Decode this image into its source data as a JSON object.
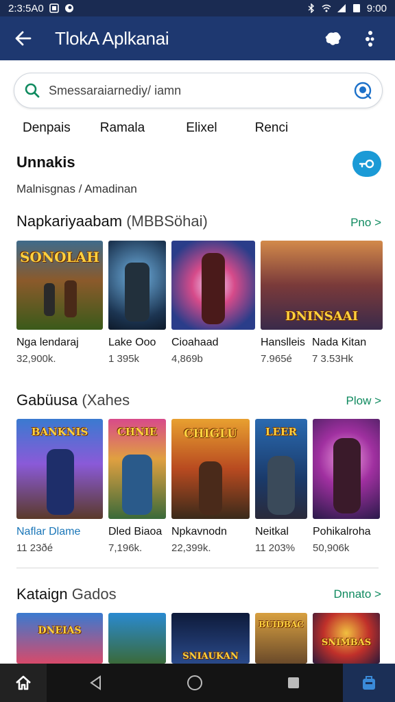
{
  "status_bar": {
    "time": "2:3:5A0",
    "clock_right": "9:00"
  },
  "app_bar": {
    "title": "Tlok​A Aplkanai"
  },
  "search": {
    "placeholder": "Smessaraiarnediy/ iamn"
  },
  "tabs": [
    "Denpais",
    "Ramala",
    "Elixel",
    "Renci"
  ],
  "user_section": {
    "title": "Unnakis",
    "breadcrumb": "Malnisgnas  /  Amadinan"
  },
  "sections": [
    {
      "title": "Napkariyaabam",
      "subtitle": "(MBBSöhai)",
      "more": "Pno >",
      "items": [
        {
          "name": "Nga lendaraj",
          "count": "32,900k.",
          "art_text": "SONOLAH"
        },
        {
          "name": "Lake Ooo",
          "count": "1 395k",
          "art_text": ""
        },
        {
          "name": "Cioahaad",
          "count": "4,869b",
          "art_text": ""
        },
        {
          "name": "Hanslleis",
          "count": "7.965é",
          "art_text": "DNINSAAI"
        },
        {
          "name": "Nada Kitan",
          "count": "7 3.53Hk",
          "art_text": ""
        }
      ]
    },
    {
      "title": "Gabüusa",
      "subtitle": "(Xahes",
      "more": "Plow >",
      "items": [
        {
          "name": "Naflar Dlame",
          "count": "11 23ðé",
          "art_text": "BANKNIS"
        },
        {
          "name": "Dled Biaoa",
          "count": "7,196k.",
          "art_text": "CHNIE"
        },
        {
          "name": "Npkavnodn",
          "count": "22,399k.",
          "art_text": "CHIGLU"
        },
        {
          "name": "Neitkal",
          "count": "11 203%",
          "art_text": "LEER"
        },
        {
          "name": "Pohikalroha",
          "count": "50,906k",
          "art_text": ""
        }
      ]
    },
    {
      "title": "Kataign",
      "subtitle": "Gados",
      "more": "Dnnato >",
      "items": [
        {
          "name": "",
          "count": "",
          "art_text": "DNEIAS"
        },
        {
          "name": "",
          "count": "",
          "art_text": ""
        },
        {
          "name": "",
          "count": "",
          "art_text": "SNIAUKAN"
        },
        {
          "name": "",
          "count": "",
          "art_text": "BUIDBAC"
        },
        {
          "name": "",
          "count": "",
          "art_text": "SNIMBAS"
        }
      ]
    }
  ],
  "colors": {
    "app_bar": "#1e3870",
    "accent_green": "#0f8a5f",
    "accent_blue": "#1b9ad6"
  },
  "icons": [
    "back-arrow-icon",
    "puzzle-icon",
    "more-vert-icon",
    "search-icon",
    "voice-search-icon",
    "key-icon",
    "home-icon",
    "nav-back-icon",
    "nav-home-icon",
    "nav-recents-icon",
    "store-icon"
  ]
}
